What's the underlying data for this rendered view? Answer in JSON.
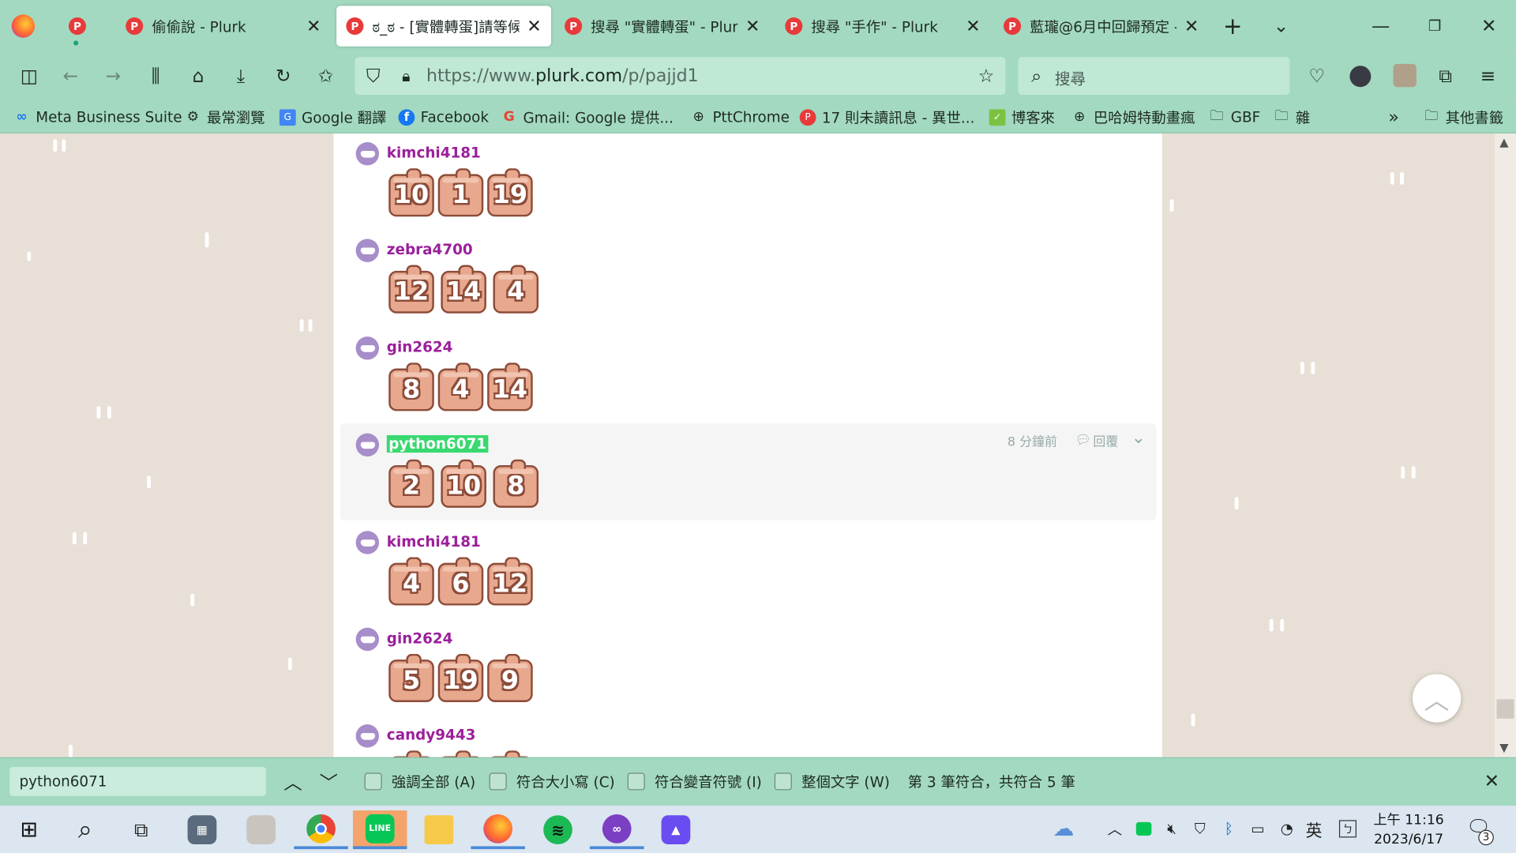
{
  "tabs": [
    {
      "label": ""
    },
    {
      "label": "偷偷說 - Plurk"
    },
    {
      "label": "ಠ_ಠ - [實體轉蛋]請等候"
    },
    {
      "label": "搜尋 \"實體轉蛋\" - Plurk"
    },
    {
      "label": "搜尋 \"手作\" - Plurk"
    },
    {
      "label": "藍瓏@6月中回歸預定 -"
    }
  ],
  "url": {
    "prefix": "https://www.",
    "domain": "plurk.com",
    "path": "/p/pajjd1"
  },
  "search": {
    "placeholder": "搜尋"
  },
  "bookmarks": [
    {
      "label": "Meta Business Suite",
      "icon": "meta-icon"
    },
    {
      "label": "最常瀏覽",
      "icon": "gear-icon"
    },
    {
      "label": "Google 翻譯",
      "icon": "translate-icon"
    },
    {
      "label": "Facebook",
      "icon": "facebook-icon"
    },
    {
      "label": "Gmail: Google 提供...",
      "icon": "google-icon"
    },
    {
      "label": "PttChrome",
      "icon": "globe-icon"
    },
    {
      "label": "17 則未讀訊息 - 異世...",
      "icon": "plurk-icon"
    },
    {
      "label": "博客來",
      "icon": "books-icon"
    },
    {
      "label": "巴哈姆特動畫瘋",
      "icon": "globe-icon"
    },
    {
      "label": "GBF",
      "icon": "folder-icon"
    },
    {
      "label": "雜",
      "icon": "folder-icon"
    },
    {
      "label": "其他書籤",
      "icon": "folder-icon"
    }
  ],
  "responses": [
    {
      "user": "kimchi4181",
      "dice": [
        "10",
        "1",
        "19"
      ]
    },
    {
      "user": "zebra4700",
      "dice": [
        "12",
        "14",
        "4"
      ]
    },
    {
      "user": "gin2624",
      "dice": [
        "8",
        "4",
        "14"
      ]
    },
    {
      "user": "python6071",
      "dice": [
        "2",
        "10",
        "8"
      ],
      "time": "8 分鐘前",
      "reply": "回覆"
    },
    {
      "user": "kimchi4181",
      "dice": [
        "4",
        "6",
        "12"
      ]
    },
    {
      "user": "gin2624",
      "dice": [
        "5",
        "19",
        "9"
      ]
    },
    {
      "user": "candy9443",
      "dice": []
    }
  ],
  "findbar": {
    "query": "python6071",
    "options": [
      "強調全部 (A)",
      "符合大小寫 (C)",
      "符合變音符號 (I)",
      "整個文字 (W)"
    ],
    "status": "第 3 筆符合，共符合 5 筆"
  },
  "taskbar": {
    "ime": "英",
    "time": "上午 11:16",
    "date": "2023/6/17",
    "notifications": "3"
  }
}
